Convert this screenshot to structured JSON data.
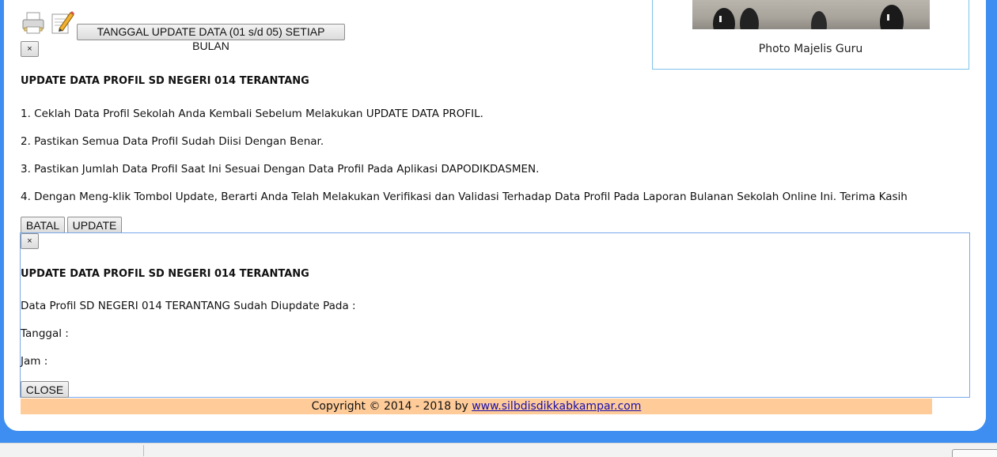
{
  "toolbar": {
    "update_schedule_button": "TANGGAL UPDATE DATA (01 s/d 05) SETIAP BULAN",
    "close_x": "×",
    "print_icon": "printer-icon",
    "edit_icon": "edit-pencil-icon"
  },
  "photo": {
    "caption": "Photo Majelis Guru"
  },
  "update_dialog": {
    "title": "UPDATE DATA PROFIL SD NEGERI 014 TERANTANG",
    "instructions": [
      "1. Ceklah Data Profil Sekolah Anda Kembali Sebelum Melakukan UPDATE DATA PROFIL.",
      "2. Pastikan Semua Data Profil Sudah Diisi Dengan Benar.",
      "3. Pastikan Jumlah Data Profil Saat Ini Sesuai Dengan Data Profil Pada Aplikasi DAPODIKDASMEN.",
      "4. Dengan Meng-klik Tombol Update, Berarti Anda Telah Melakukan Verifikasi dan Validasi Terhadap Data Profil Pada Laporan Bulanan Sekolah Online Ini. Terima Kasih"
    ],
    "cancel_button": "BATAL",
    "update_button": "UPDATE"
  },
  "result_dialog": {
    "close_x": "×",
    "title": "UPDATE DATA PROFIL SD NEGERI 014 TERANTANG",
    "message": "Data Profil SD NEGERI 014 TERANTANG Sudah Diupdate Pada :",
    "date_label": "Tanggal :",
    "time_label": "Jam :",
    "close_button": "CLOSE"
  },
  "footer": {
    "copyright": "Copyright © 2014 - 2018 by",
    "link": "www.silbdisdikkabkampar.com"
  },
  "colors": {
    "background": "#3d8ef0",
    "footer_bg": "#ffcc99",
    "dialog_border": "#7aa8e8",
    "link": "#1a0dab"
  }
}
